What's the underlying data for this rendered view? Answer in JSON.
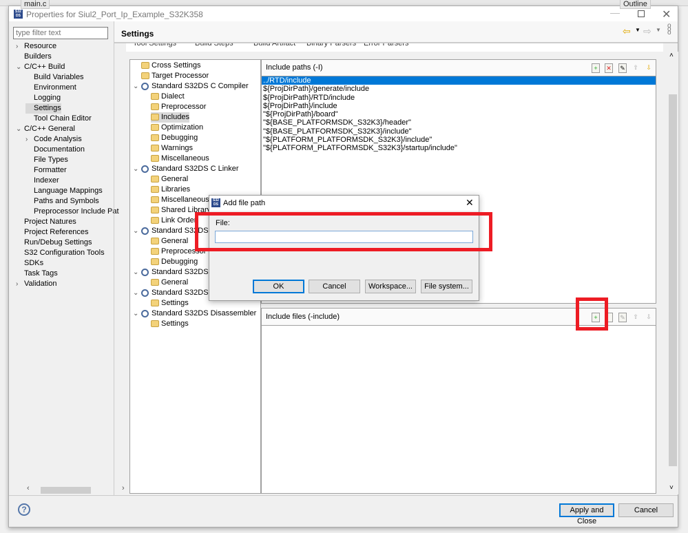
{
  "background": {
    "editor_tab": "main.c",
    "outline_tab": "Outline"
  },
  "window": {
    "title": "Properties for Siul2_Port_Ip_Example_S32K358",
    "logo": "S32DS"
  },
  "filter": {
    "placeholder": "type filter text"
  },
  "left_tree": [
    {
      "label": "Resource",
      "level": 0,
      "chevron": "right"
    },
    {
      "label": "Builders",
      "level": 0
    },
    {
      "label": "C/C++ Build",
      "level": 0,
      "chevron": "down"
    },
    {
      "label": "Build Variables",
      "level": 1
    },
    {
      "label": "Environment",
      "level": 1
    },
    {
      "label": "Logging",
      "level": 1
    },
    {
      "label": "Settings",
      "level": 1,
      "selected": true
    },
    {
      "label": "Tool Chain Editor",
      "level": 1
    },
    {
      "label": "C/C++ General",
      "level": 0,
      "chevron": "down"
    },
    {
      "label": "Code Analysis",
      "level": 1,
      "chevron": "right"
    },
    {
      "label": "Documentation",
      "level": 1
    },
    {
      "label": "File Types",
      "level": 1
    },
    {
      "label": "Formatter",
      "level": 1
    },
    {
      "label": "Indexer",
      "level": 1
    },
    {
      "label": "Language Mappings",
      "level": 1
    },
    {
      "label": "Paths and Symbols",
      "level": 1
    },
    {
      "label": "Preprocessor Include Pat",
      "level": 1
    },
    {
      "label": "Project Natures",
      "level": 0
    },
    {
      "label": "Project References",
      "level": 0
    },
    {
      "label": "Run/Debug Settings",
      "level": 0
    },
    {
      "label": "S32 Configuration Tools",
      "level": 0
    },
    {
      "label": "SDKs",
      "level": 0
    },
    {
      "label": "Task Tags",
      "level": 0
    },
    {
      "label": "Validation",
      "level": 0,
      "chevron": "right"
    }
  ],
  "page": {
    "title": "Settings"
  },
  "tabs": [
    "Tool Settings",
    "Build Steps",
    "Build Artifact",
    "Binary Parsers",
    "Error Parsers"
  ],
  "tool_tree": [
    {
      "label": "Cross Settings",
      "level": 1,
      "icon": "folder"
    },
    {
      "label": "Target Processor",
      "level": 1,
      "icon": "folder"
    },
    {
      "label": "Standard S32DS C Compiler",
      "level": 0,
      "icon": "gear"
    },
    {
      "label": "Dialect",
      "level": 2,
      "icon": "folder"
    },
    {
      "label": "Preprocessor",
      "level": 2,
      "icon": "folder"
    },
    {
      "label": "Includes",
      "level": 2,
      "icon": "folder",
      "selected": true
    },
    {
      "label": "Optimization",
      "level": 2,
      "icon": "folder"
    },
    {
      "label": "Debugging",
      "level": 2,
      "icon": "folder"
    },
    {
      "label": "Warnings",
      "level": 2,
      "icon": "folder"
    },
    {
      "label": "Miscellaneous",
      "level": 2,
      "icon": "folder"
    },
    {
      "label": "Standard S32DS C Linker",
      "level": 0,
      "icon": "gear"
    },
    {
      "label": "General",
      "level": 2,
      "icon": "folder"
    },
    {
      "label": "Libraries",
      "level": 2,
      "icon": "folder"
    },
    {
      "label": "Miscellaneous",
      "level": 2,
      "icon": "folder"
    },
    {
      "label": "Shared Library Settings",
      "level": 2,
      "icon": "folder"
    },
    {
      "label": "Link Order",
      "level": 2,
      "icon": "folder"
    },
    {
      "label": "Standard S32DS Assembler",
      "level": 0,
      "icon": "gear"
    },
    {
      "label": "General",
      "level": 2,
      "icon": "folder"
    },
    {
      "label": "Preprocessor",
      "level": 2,
      "icon": "folder"
    },
    {
      "label": "Debugging",
      "level": 2,
      "icon": "folder"
    },
    {
      "label": "Standard S32DS Printsize",
      "level": 0,
      "icon": "gear"
    },
    {
      "label": "General",
      "level": 2,
      "icon": "folder"
    },
    {
      "label": "Standard S32DS C Preprocessor",
      "level": 0,
      "icon": "gear"
    },
    {
      "label": "Settings",
      "level": 2,
      "icon": "folder"
    },
    {
      "label": "Standard S32DS Disassembler",
      "level": 0,
      "icon": "gear"
    },
    {
      "label": "Settings",
      "level": 2,
      "icon": "folder"
    }
  ],
  "include_paths": {
    "title": "Include paths (-I)",
    "items": [
      "../RTD/include",
      "${ProjDirPath}/generate/include",
      "${ProjDirPath}/RTD/include",
      "${ProjDirPath}/include",
      "\"${ProjDirPath}/board\"",
      "\"${BASE_PLATFORMSDK_S32K3}/header\"",
      "\"${BASE_PLATFORMSDK_S32K3}/include\"",
      "\"${PLATFORM_PLATFORMSDK_S32K3}/include\"",
      "\"${PLATFORM_PLATFORMSDK_S32K3}/startup/include\""
    ],
    "selected": 0
  },
  "include_files": {
    "title": "Include files (-include)",
    "items": []
  },
  "footer": {
    "apply_close": "Apply and Close",
    "cancel": "Cancel"
  },
  "dialog": {
    "title": "Add file path",
    "file_label": "File:",
    "file_value": "",
    "ok": "OK",
    "cancel": "Cancel",
    "workspace": "Workspace...",
    "file_system": "File system..."
  },
  "colors": {
    "selection": "#0078d7",
    "highlight": "#ed1c24"
  }
}
